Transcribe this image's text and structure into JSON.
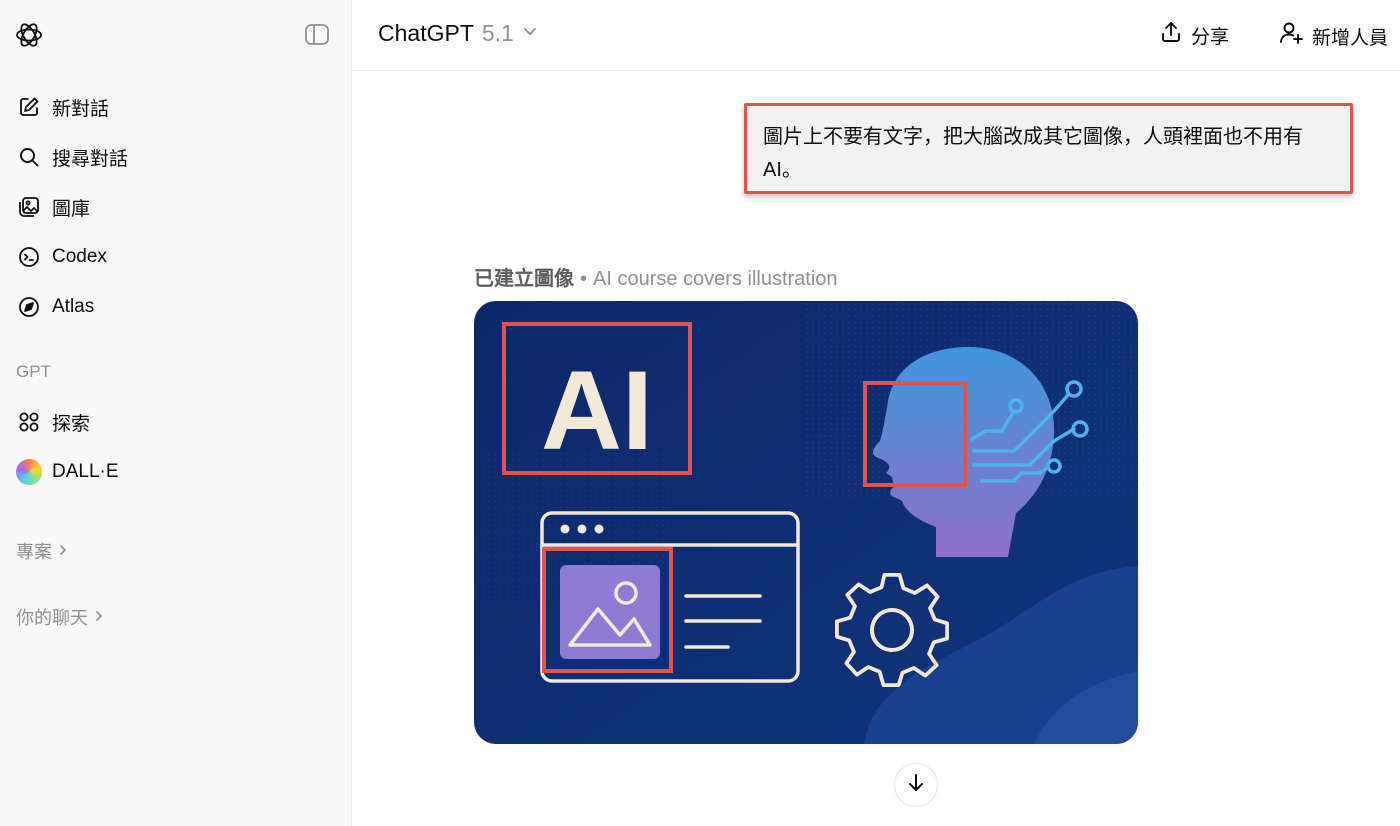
{
  "sidebar": {
    "nav_items": [
      {
        "label": "新對話",
        "icon": "edit-icon"
      },
      {
        "label": "搜尋對話",
        "icon": "search-icon"
      },
      {
        "label": "圖庫",
        "icon": "gallery-icon"
      },
      {
        "label": "Codex",
        "icon": "codex-icon"
      },
      {
        "label": "Atlas",
        "icon": "compass-icon"
      }
    ],
    "gpt_section_title": "GPT",
    "gpt_items": [
      {
        "label": "探索",
        "icon": "grid-icon"
      },
      {
        "label": "DALL·E",
        "icon": "dalle-avatar"
      }
    ],
    "projects_label": "專案",
    "chats_label": "你的聊天"
  },
  "header": {
    "model_name": "ChatGPT",
    "model_version": "5.1",
    "share_label": "分享",
    "add_people_label": "新增人員"
  },
  "conversation": {
    "user_message": "圖片上不要有文字，把大腦改成其它圖像，人頭裡面也不用有AI。",
    "created_label": "已建立圖像",
    "separator": "•",
    "image_title": "AI course covers illustration",
    "image_text": "AI"
  },
  "colors": {
    "annotation_red": "#e0544f",
    "image_bg": "#0f2e72",
    "cream": "#f3e9d6"
  }
}
